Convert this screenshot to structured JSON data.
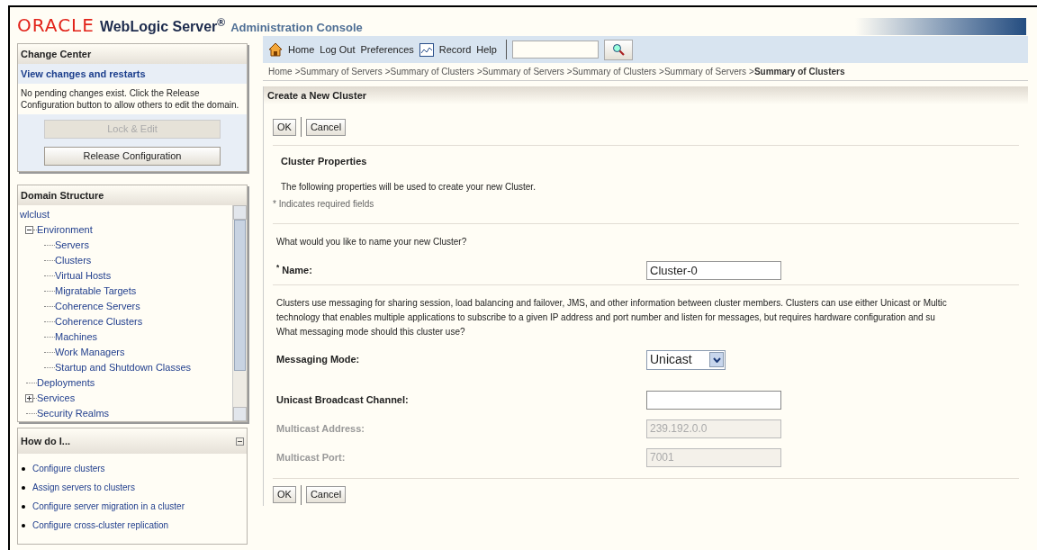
{
  "header": {
    "brand": "ORACLE",
    "product": "WebLogic Server",
    "product_mark": "®",
    "subtitle": "Administration Console"
  },
  "change_center": {
    "title": "Change Center",
    "link": "View changes and restarts",
    "message": "No pending changes exist. Click the Release Configuration button to allow others to edit the domain.",
    "buttons": [
      {
        "label": "Lock & Edit",
        "disabled": true
      },
      {
        "label": "Release Configuration",
        "disabled": false
      }
    ]
  },
  "domain_structure": {
    "title": "Domain Structure",
    "tree": [
      {
        "label": "wlclust",
        "children": [
          {
            "label": "Environment",
            "expanded": true,
            "children": [
              {
                "label": "Servers"
              },
              {
                "label": "Clusters"
              },
              {
                "label": "Virtual Hosts"
              },
              {
                "label": "Migratable Targets"
              },
              {
                "label": "Coherence Servers"
              },
              {
                "label": "Coherence Clusters"
              },
              {
                "label": "Machines"
              },
              {
                "label": "Work Managers"
              },
              {
                "label": "Startup and Shutdown Classes"
              }
            ]
          },
          {
            "label": "Deployments"
          },
          {
            "label": "Services",
            "expanded": false
          },
          {
            "label": "Security Realms"
          }
        ]
      }
    ]
  },
  "how_do_i": {
    "title": "How do I...",
    "links": [
      "Configure clusters",
      "Assign servers to clusters",
      "Configure server migration in a cluster",
      "Configure cross-cluster replication"
    ]
  },
  "toolbar": {
    "items": [
      {
        "label": "Home",
        "kind": "home"
      },
      {
        "label": "Log Out",
        "kind": "text"
      },
      {
        "label": "Preferences",
        "kind": "text"
      },
      {
        "label": "Record",
        "kind": "record"
      },
      {
        "label": "Help",
        "kind": "text"
      }
    ]
  },
  "breadcrumb": [
    {
      "label": "Home",
      "current": false
    },
    {
      "label": "Summary of Servers",
      "current": false
    },
    {
      "label": "Summary of Clusters",
      "current": false
    },
    {
      "label": "Summary of Servers",
      "current": false
    },
    {
      "label": "Summary of Clusters",
      "current": false
    },
    {
      "label": "Summary of Servers",
      "current": false
    },
    {
      "label": "Summary of Clusters",
      "current": true
    }
  ],
  "breadcrumb_separator": ">",
  "form": {
    "title": "Create a New Cluster",
    "buttons": [
      "OK",
      "Cancel"
    ],
    "section_title": "Cluster Properties",
    "intro": "The following properties will be used to create your new Cluster.",
    "required_note": "* Indicates required fields",
    "name_question": "What would you like to name your new Cluster?",
    "name_field": {
      "label": "Name:",
      "required": true,
      "required_mark": "*",
      "value": "Cluster-0",
      "disabled": false
    },
    "messaging_text": [
      "Clusters use messaging for sharing session, load balancing and failover, JMS, and other information between cluster members. Clusters can use either Unicast or Multic",
      "technology that enables multiple applications to subscribe to a given IP address and port number and listen for messages, but requires hardware configuration and su",
      "What messaging mode should this cluster use?"
    ],
    "fields": [
      {
        "label": "Messaging Mode:",
        "kind": "select",
        "value": "Unicast",
        "disabled": false
      },
      {
        "label": "Unicast Broadcast Channel:",
        "kind": "text",
        "disabled": false
      },
      {
        "label": "Multicast Address:",
        "kind": "text",
        "value": "239.192.0.0",
        "disabled": true
      },
      {
        "label": "Multicast Port:",
        "kind": "text",
        "value": "7001",
        "disabled": true
      }
    ],
    "bottom_buttons": [
      "OK",
      "Cancel"
    ]
  }
}
